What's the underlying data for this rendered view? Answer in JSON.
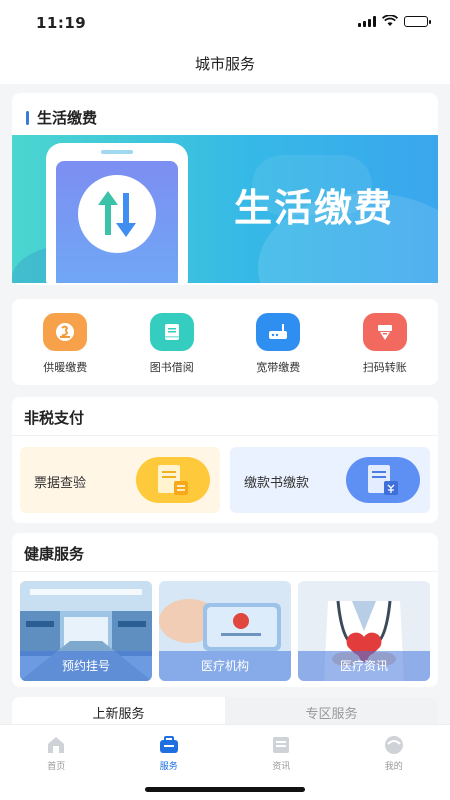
{
  "status": {
    "time": "11:19"
  },
  "navbar": {
    "title": "城市服务"
  },
  "life_payment": {
    "title": "生活缴费",
    "banner_text": "生活缴费",
    "items": [
      {
        "label": "供暖缴费",
        "icon": "heating-icon",
        "color": "#f59a3b"
      },
      {
        "label": "图书借阅",
        "icon": "book-icon",
        "color": "#2cc6b8"
      },
      {
        "label": "宽带缴费",
        "icon": "router-icon",
        "color": "#2f8ff0"
      },
      {
        "label": "扫码转账",
        "icon": "scan-transfer-icon",
        "color": "#f0645a"
      }
    ]
  },
  "non_tax": {
    "title": "非税支付",
    "items": [
      {
        "label": "票据查验",
        "icon": "receipt-check-icon"
      },
      {
        "label": "缴款书缴款",
        "icon": "payment-document-icon"
      }
    ]
  },
  "health": {
    "title": "健康服务",
    "items": [
      {
        "label": "预约挂号",
        "icon": "hospital-hall-image"
      },
      {
        "label": "医疗机构",
        "icon": "medical-card-image"
      },
      {
        "label": "医疗资讯",
        "icon": "doctor-heart-image"
      }
    ]
  },
  "bottom_tabs": {
    "active": "上新服务",
    "inactive": "专区服务"
  },
  "tabbar": [
    {
      "label": "首页",
      "icon": "home-icon",
      "active": false
    },
    {
      "label": "服务",
      "icon": "service-icon",
      "active": true
    },
    {
      "label": "资讯",
      "icon": "news-icon",
      "active": false
    },
    {
      "label": "我的",
      "icon": "profile-icon",
      "active": false
    }
  ]
}
